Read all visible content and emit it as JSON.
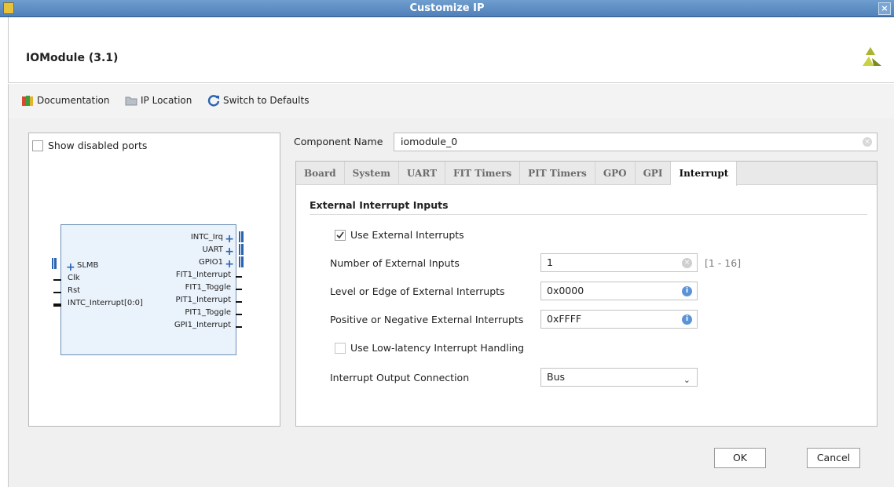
{
  "window": {
    "title": "Customize IP"
  },
  "header": {
    "ip_name": "IOModule (3.1)"
  },
  "toolbar": {
    "documentation": "Documentation",
    "ip_location": "IP Location",
    "switch_defaults": "Switch to Defaults"
  },
  "symbol": {
    "show_disabled_label": "Show disabled ports",
    "right_ports": [
      "INTC_Irq",
      "UART",
      "GPIO1",
      "FIT1_Interrupt",
      "FIT1_Toggle",
      "PIT1_Interrupt",
      "PIT1_Toggle",
      "GPI1_Interrupt"
    ],
    "left_ports": [
      "SLMB",
      "Clk",
      "Rst",
      "INTC_Interrupt[0:0]"
    ]
  },
  "component": {
    "label": "Component Name",
    "value": "iomodule_0"
  },
  "tabs": [
    "Board",
    "System",
    "UART",
    "FIT Timers",
    "PIT Timers",
    "GPO",
    "GPI",
    "Interrupt"
  ],
  "active_tab": "Interrupt",
  "interrupt": {
    "section_title": "External Interrupt Inputs",
    "use_external_label": "Use External Interrupts",
    "use_external_checked": true,
    "num_inputs_label": "Number of External Inputs",
    "num_inputs_value": "1",
    "num_inputs_range": "[1 - 16]",
    "level_edge_label": "Level or Edge of External Interrupts",
    "level_edge_value": "0x0000",
    "pos_neg_label": "Positive or Negative External Interrupts",
    "pos_neg_value": "0xFFFF",
    "low_latency_label": "Use Low-latency Interrupt Handling",
    "low_latency_checked": false,
    "output_conn_label": "Interrupt Output Connection",
    "output_conn_value": "Bus"
  },
  "buttons": {
    "ok": "OK",
    "cancel": "Cancel"
  }
}
